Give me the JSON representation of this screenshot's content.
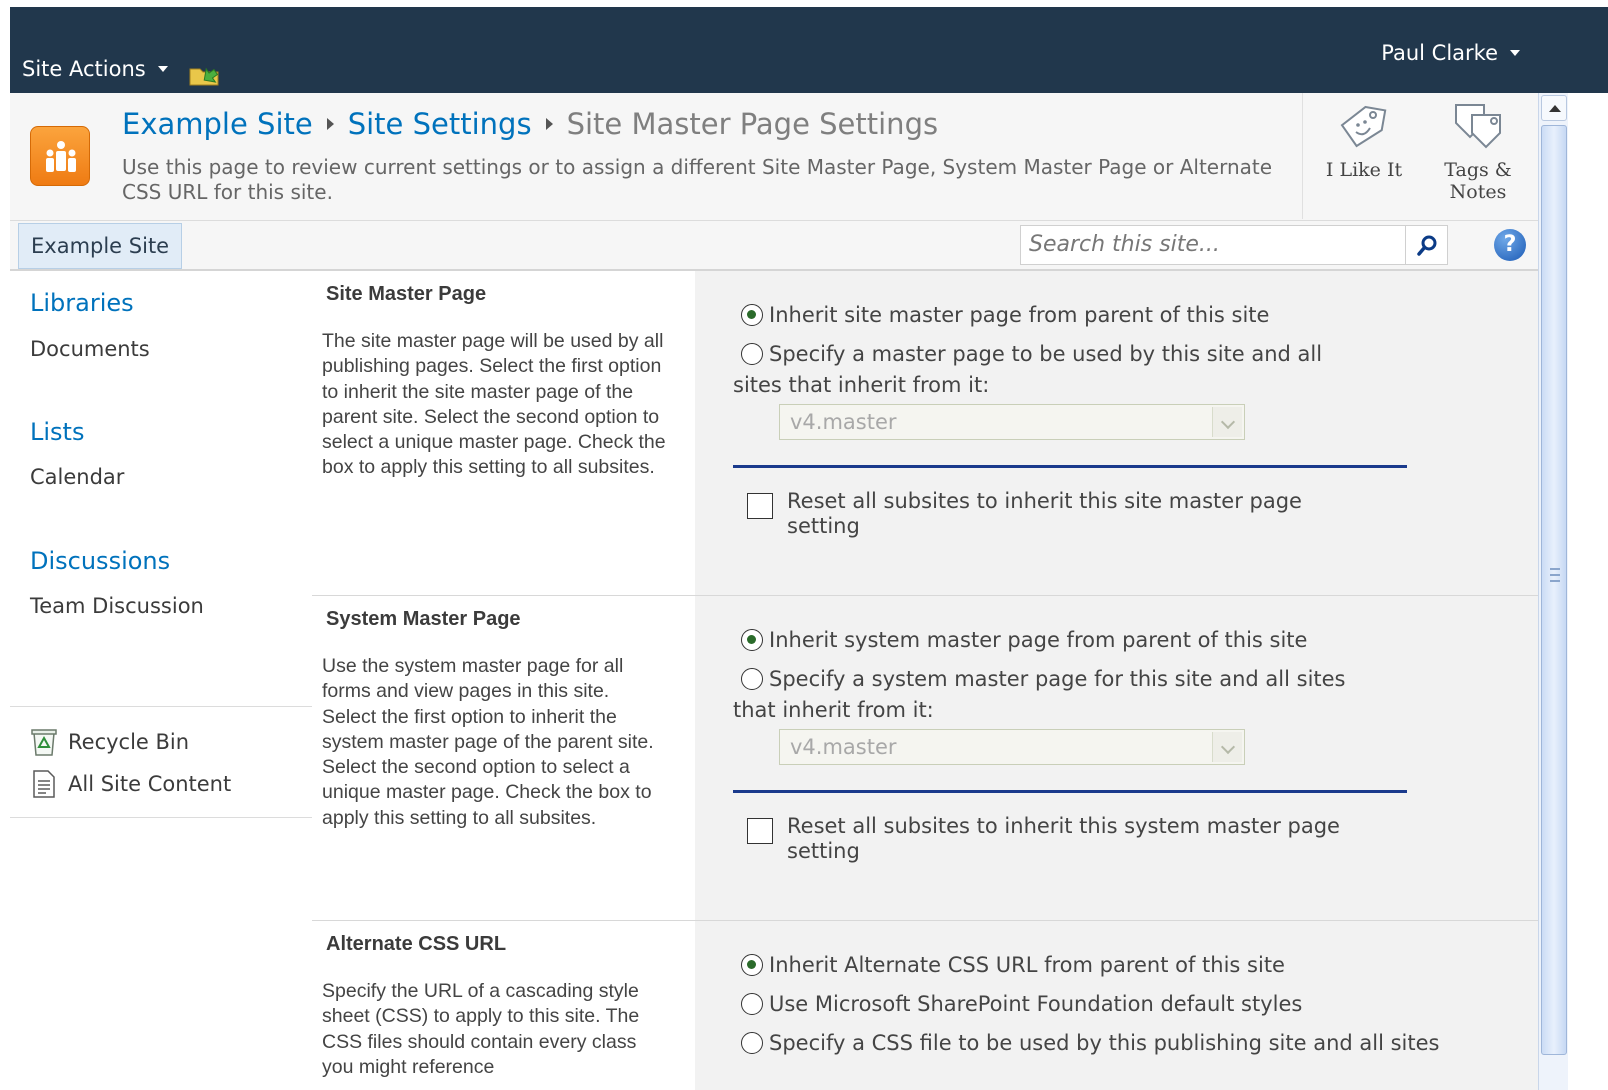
{
  "topbar": {
    "site_actions": "Site Actions",
    "user_name": "Paul Clarke"
  },
  "titlearea": {
    "breadcrumb": [
      "Example Site",
      "Site Settings",
      "Site Master Page Settings"
    ],
    "description": "Use this page to review current settings or to assign a different Site Master Page, System Master Page or Alternate CSS URL for this site.",
    "social": {
      "like_label": "I Like It",
      "tags_label_1": "Tags &",
      "tags_label_2": "Notes"
    }
  },
  "navbar": {
    "tab_label": "Example Site",
    "search_placeholder": "Search this site..."
  },
  "leftnav": {
    "libraries_heading": "Libraries",
    "libraries_items": [
      "Documents"
    ],
    "lists_heading": "Lists",
    "lists_items": [
      "Calendar"
    ],
    "discussions_heading": "Discussions",
    "discussions_items": [
      "Team Discussion"
    ],
    "recycle_bin": "Recycle Bin",
    "all_site_content": "All Site Content"
  },
  "sections": [
    {
      "title": "Site Master Page",
      "description": "The site master page will be used by all publishing pages. Select the first option to inherit the site master page of the parent site. Select the second option to select a unique master page. Check the box to apply this setting to all subsites.",
      "option_inherit": "Inherit site master page from parent of this site",
      "option_specify_line1": "Specify a master page to be used by this site and all",
      "option_specify_line2": "sites that inherit from it:",
      "selected_master": "v4.master",
      "reset_label": "Reset all subsites to inherit this site master page setting",
      "inherit_checked": true,
      "reset_checked": false
    },
    {
      "title": "System Master Page",
      "description": "Use the system master page for all forms and view pages in this site. Select the first option to inherit the system master page of the parent site. Select the second option to select a unique master page. Check the box to apply this setting to all subsites.",
      "option_inherit": "Inherit system master page from parent of this site",
      "option_specify_line1": "Specify a system master page for this site and all sites",
      "option_specify_line2": "that inherit from it:",
      "selected_master": "v4.master",
      "reset_label": "Reset all subsites to inherit this system master page setting",
      "inherit_checked": true,
      "reset_checked": false
    },
    {
      "title": "Alternate CSS URL",
      "description": "Specify the URL of a cascading style sheet (CSS) to apply to this site. The CSS files should contain every class you might reference",
      "option_inherit": "Inherit Alternate CSS URL from parent of this site",
      "option_default": "Use Microsoft SharePoint Foundation default styles",
      "option_specify": "Specify a CSS file to be used by this publishing site and all sites",
      "inherit_checked": true
    }
  ],
  "colors": {
    "topbar_bg": "#21374c",
    "link_blue": "#0072bc",
    "logo_orange": "#f58a1f",
    "divider_blue": "#1a3a8c"
  }
}
